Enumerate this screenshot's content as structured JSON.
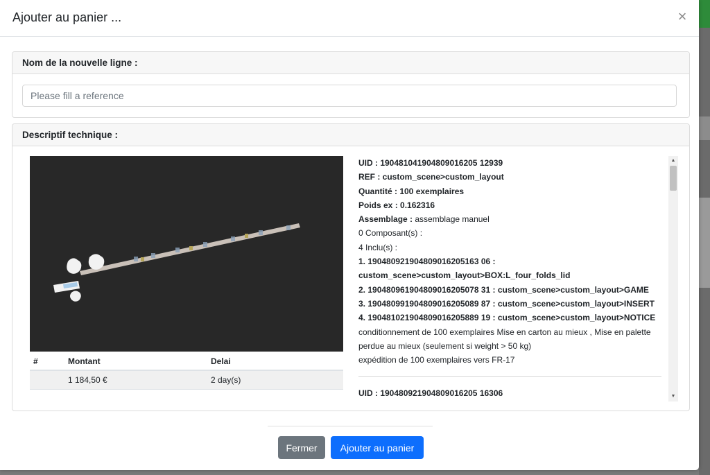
{
  "modal": {
    "title": "Ajouter au panier ...",
    "close_label": "×"
  },
  "new_line": {
    "header": "Nom de la nouvelle ligne :",
    "placeholder": "Please fill a reference"
  },
  "technical": {
    "header": "Descriptif technique :",
    "table": {
      "headers": [
        "#",
        "Montant",
        "Delai"
      ],
      "rows": [
        [
          "",
          "1 184,50 €",
          "2 day(s)"
        ]
      ]
    },
    "details": {
      "uid": "UID : 190481041904809016205 12939",
      "ref": "REF : custom_scene>custom_layout",
      "quantite": "Quantité : 100 exemplaires",
      "poids": "Poids ex : 0.162316",
      "assemblage_label": "Assemblage :",
      "assemblage_value": " assemblage manuel",
      "composants": "0 Composant(s) :",
      "inclus": "4 Inclu(s) :",
      "items": [
        "1. 190480921904809016205163 06 : custom_scene>custom_layout>BOX:L_four_folds_lid",
        "2. 190480961904809016205078 31 : custom_scene>custom_layout>GAME",
        "3. 190480991904809016205089 87 : custom_scene>custom_layout>INSERT",
        "4. 190481021904809016205889 19 : custom_scene>custom_layout>NOTICE"
      ],
      "conditionnement": "conditionnement de 100 exemplaires Mise en carton au mieux , Mise en palette perdue au mieux (seulement si weight > 50 kg)",
      "expedition": "expédition de 100 exemplaires vers FR-17",
      "next_uid": "UID : 190480921904809016205 16306"
    }
  },
  "footer": {
    "close_button": "Fermer",
    "add_button": "Ajouter au panier"
  },
  "colors": {
    "primary": "#0d6efd",
    "secondary": "#6c757d",
    "preview_bg": "#282828"
  }
}
